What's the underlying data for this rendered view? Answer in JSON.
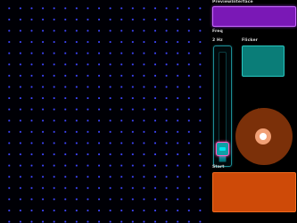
{
  "grid": {
    "dot_color": "#3f46ff",
    "background": "#000005"
  },
  "preview": {
    "label": "PreviewInterface",
    "color": "#7a18b6"
  },
  "freq": {
    "label": "Freq",
    "value_text": "2 Hz",
    "level_fraction": 0.08
  },
  "flicker": {
    "label": "Flicker",
    "color": "#0a7d78"
  },
  "range": {
    "label": "Range",
    "color": "#7b3009"
  },
  "start": {
    "label": "Start",
    "color": "#ce4a08"
  }
}
